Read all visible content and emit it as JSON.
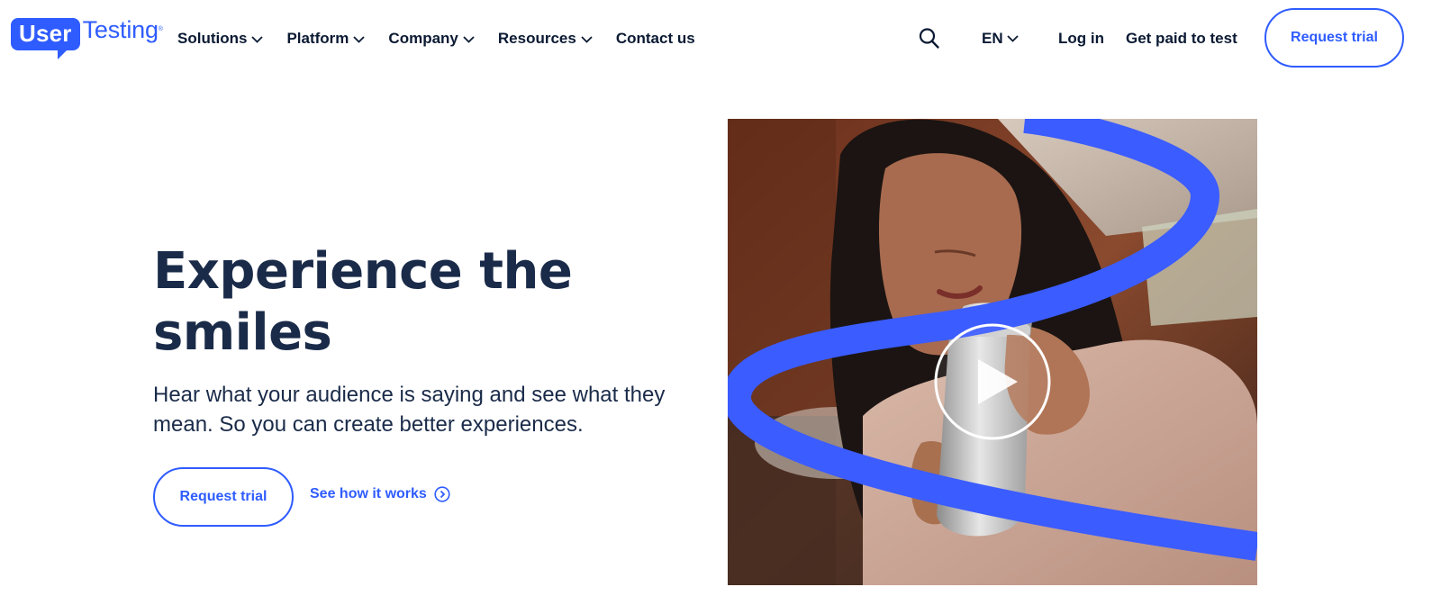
{
  "brand": {
    "logo_part1": "User",
    "logo_part2": "Testing",
    "logo_reg": "®",
    "accent_color": "#2f5cff",
    "text_color": "#1a2b49"
  },
  "nav": {
    "items": [
      {
        "label": "Solutions",
        "dropdown": true
      },
      {
        "label": "Platform",
        "dropdown": true
      },
      {
        "label": "Company",
        "dropdown": true
      },
      {
        "label": "Resources",
        "dropdown": true
      },
      {
        "label": "Contact us",
        "dropdown": false
      }
    ],
    "search_icon": "search-icon",
    "language": "EN",
    "login": "Log in",
    "get_paid": "Get paid to test",
    "request_trial": "Request trial"
  },
  "hero": {
    "title": "Experience the smiles",
    "subtitle": "Hear what your audience is saying and see what they mean. So you can create better experiences.",
    "primary_cta": "Request trial",
    "secondary_cta": "See how it works",
    "secondary_icon": "chevron-right-circle-icon",
    "media_play_icon": "play-icon"
  }
}
